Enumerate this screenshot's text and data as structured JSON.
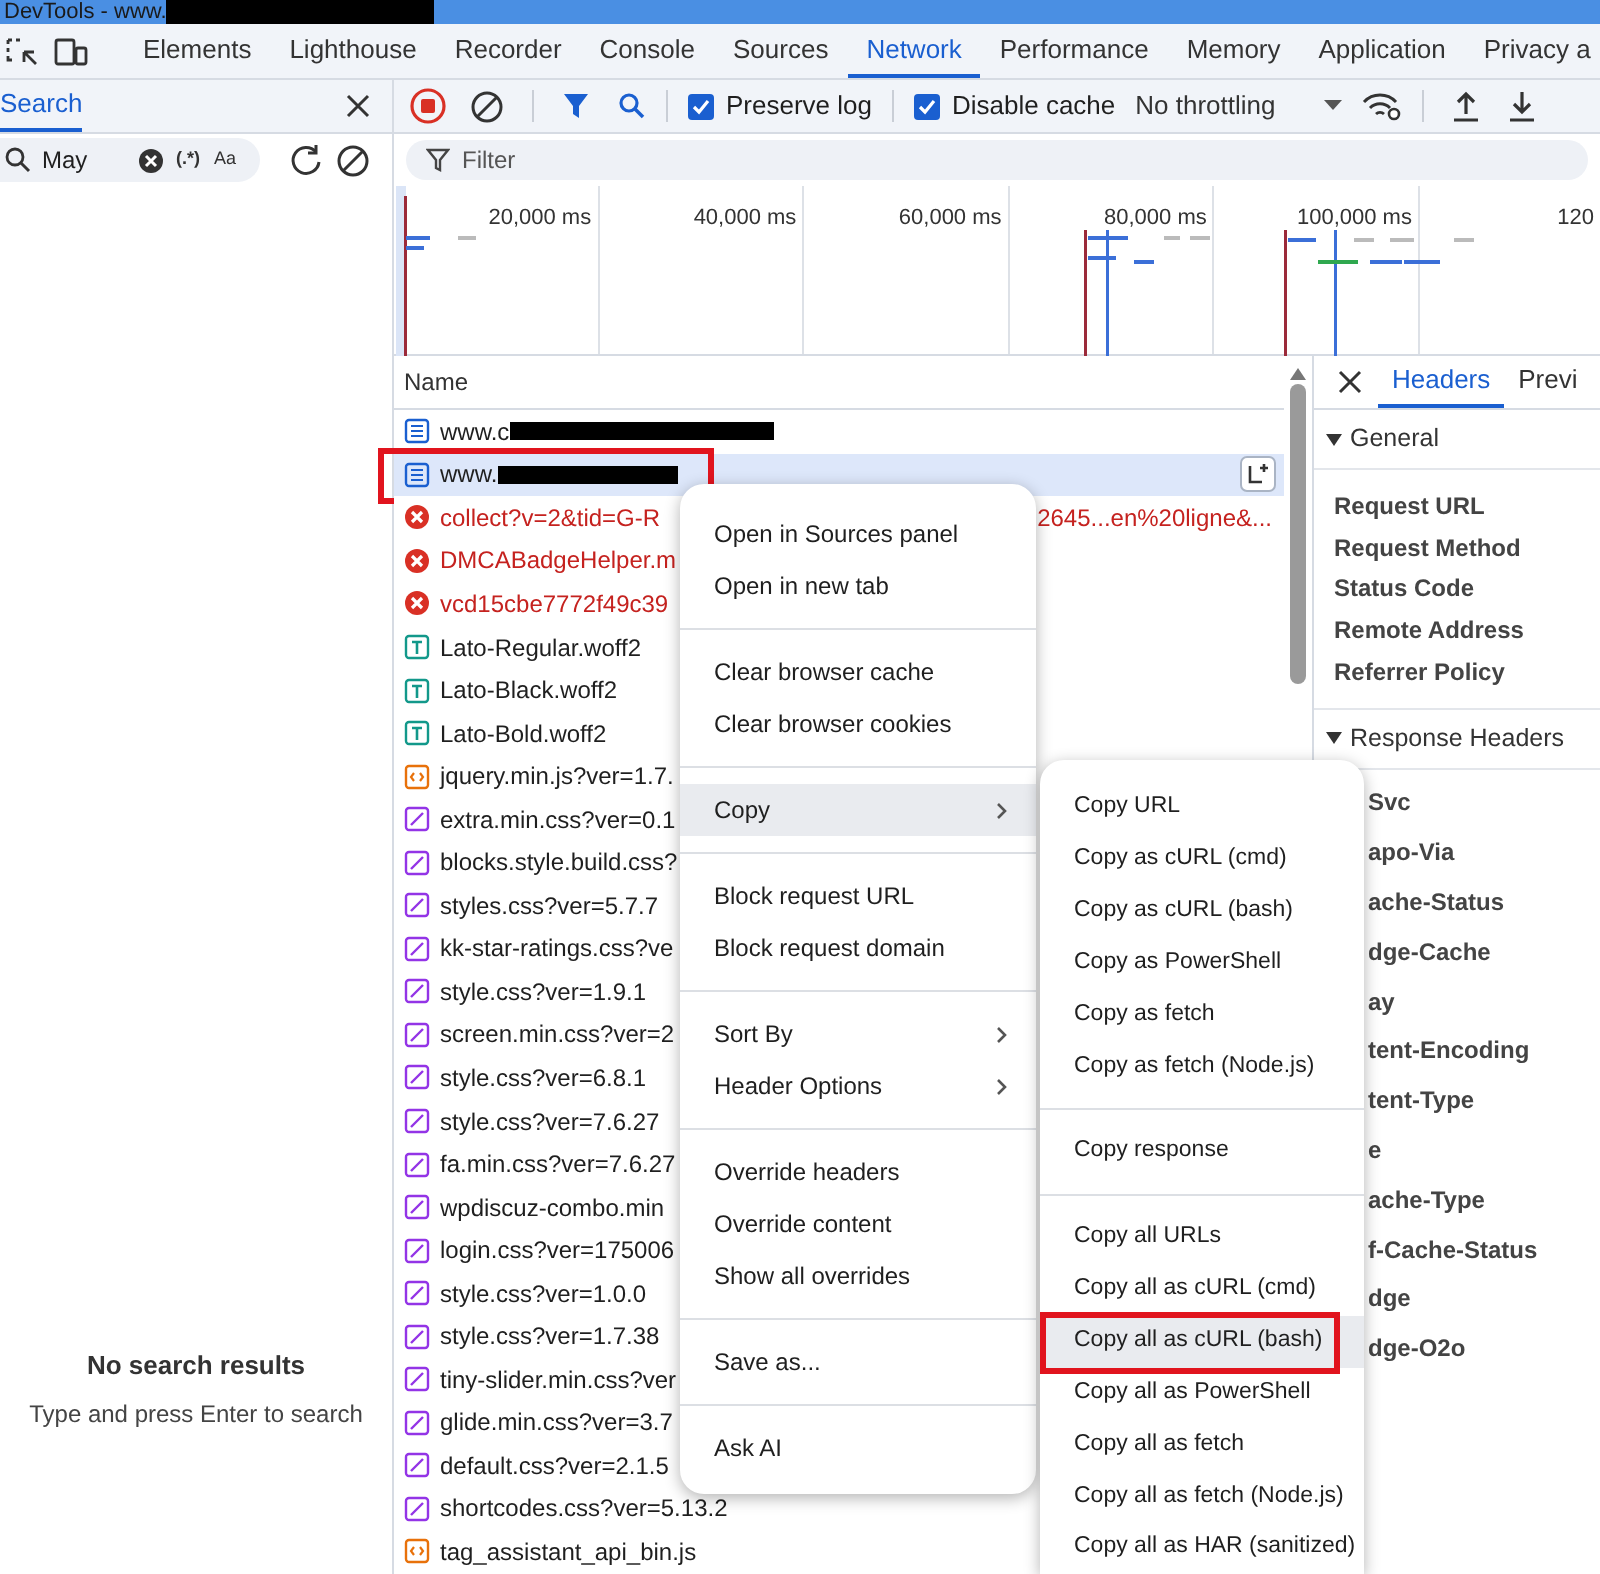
{
  "window": {
    "title": "DevTools - www."
  },
  "main_tabs": [
    {
      "label": "Elements",
      "selected": false
    },
    {
      "label": "Lighthouse",
      "selected": false
    },
    {
      "label": "Recorder",
      "selected": false
    },
    {
      "label": "Console",
      "selected": false
    },
    {
      "label": "Sources",
      "selected": false
    },
    {
      "label": "Network",
      "selected": true
    },
    {
      "label": "Performance",
      "selected": false
    },
    {
      "label": "Memory",
      "selected": false
    },
    {
      "label": "Application",
      "selected": false
    },
    {
      "label": "Privacy a",
      "selected": false
    }
  ],
  "search_panel": {
    "tab": {
      "label": "Search",
      "selected": true
    },
    "query": "May",
    "regex_label": "(.*)",
    "case_label": "Aa",
    "empty_title": "No search results",
    "empty_hint": "Type and press Enter to search"
  },
  "network_toolbar": {
    "recording": true,
    "preserve_log": {
      "label": "Preserve log",
      "checked": true
    },
    "disable_cache": {
      "label": "Disable cache",
      "checked": true
    },
    "throttling": "No throttling"
  },
  "filter": {
    "placeholder": "Filter"
  },
  "timeline": {
    "ticks": [
      "20,000 ms",
      "40,000 ms",
      "60,000 ms",
      "80,000 ms",
      "100,000 ms",
      "120"
    ]
  },
  "requests": {
    "column": "Name",
    "rows": [
      {
        "name": "www.c",
        "kind": "doc",
        "redacted": true,
        "selected": false,
        "annotated": false
      },
      {
        "name": "www.",
        "kind": "doc",
        "redacted": true,
        "selected": true,
        "annotated": true
      },
      {
        "name": "collect?v=2&tid=G-R",
        "tail": "2645...en%20ligne&...",
        "kind": "error",
        "redacted": false,
        "selected": false,
        "annotated": false
      },
      {
        "name": "DMCABadgeHelper.m",
        "kind": "error",
        "redacted": false,
        "selected": false,
        "annotated": false
      },
      {
        "name": "vcd15cbe7772f49c39",
        "kind": "error",
        "redacted": false,
        "selected": false,
        "annotated": false
      },
      {
        "name": "Lato-Regular.woff2",
        "kind": "font",
        "redacted": false,
        "selected": false,
        "annotated": false
      },
      {
        "name": "Lato-Black.woff2",
        "kind": "font",
        "redacted": false,
        "selected": false,
        "annotated": false
      },
      {
        "name": "Lato-Bold.woff2",
        "kind": "font",
        "redacted": false,
        "selected": false,
        "annotated": false
      },
      {
        "name": "jquery.min.js?ver=1.7.",
        "kind": "script",
        "redacted": false,
        "selected": false,
        "annotated": false
      },
      {
        "name": "extra.min.css?ver=0.1",
        "kind": "css",
        "redacted": false,
        "selected": false,
        "annotated": false
      },
      {
        "name": "blocks.style.build.css?",
        "kind": "css",
        "redacted": false,
        "selected": false,
        "annotated": false
      },
      {
        "name": "styles.css?ver=5.7.7",
        "kind": "css",
        "redacted": false,
        "selected": false,
        "annotated": false
      },
      {
        "name": "kk-star-ratings.css?ve",
        "kind": "css",
        "redacted": false,
        "selected": false,
        "annotated": false
      },
      {
        "name": "style.css?ver=1.9.1",
        "kind": "css",
        "redacted": false,
        "selected": false,
        "annotated": false
      },
      {
        "name": "screen.min.css?ver=2",
        "kind": "css",
        "redacted": false,
        "selected": false,
        "annotated": false
      },
      {
        "name": "style.css?ver=6.8.1",
        "kind": "css",
        "redacted": false,
        "selected": false,
        "annotated": false
      },
      {
        "name": "style.css?ver=7.6.27",
        "kind": "css",
        "redacted": false,
        "selected": false,
        "annotated": false
      },
      {
        "name": "fa.min.css?ver=7.6.27",
        "kind": "css",
        "redacted": false,
        "selected": false,
        "annotated": false
      },
      {
        "name": "wpdiscuz-combo.min",
        "kind": "css",
        "redacted": false,
        "selected": false,
        "annotated": false
      },
      {
        "name": "login.css?ver=175006",
        "kind": "css",
        "redacted": false,
        "selected": false,
        "annotated": false
      },
      {
        "name": "style.css?ver=1.0.0",
        "kind": "css",
        "redacted": false,
        "selected": false,
        "annotated": false
      },
      {
        "name": "style.css?ver=1.7.38",
        "kind": "css",
        "redacted": false,
        "selected": false,
        "annotated": false
      },
      {
        "name": "tiny-slider.min.css?ver",
        "kind": "css",
        "redacted": false,
        "selected": false,
        "annotated": false
      },
      {
        "name": "glide.min.css?ver=3.7",
        "kind": "css",
        "redacted": false,
        "selected": false,
        "annotated": false
      },
      {
        "name": "default.css?ver=2.1.5",
        "kind": "css",
        "redacted": false,
        "selected": false,
        "annotated": false
      },
      {
        "name": "shortcodes.css?ver=5.13.2",
        "kind": "css",
        "redacted": false,
        "selected": false,
        "annotated": false
      },
      {
        "name": "tag_assistant_api_bin.js",
        "kind": "script",
        "redacted": false,
        "selected": false,
        "annotated": false
      }
    ]
  },
  "context_menu": {
    "items": [
      {
        "kind": "item",
        "label": "Open in Sources panel"
      },
      {
        "kind": "item",
        "label": "Open in new tab"
      },
      {
        "kind": "separator"
      },
      {
        "kind": "item",
        "label": "Clear browser cache"
      },
      {
        "kind": "item",
        "label": "Clear browser cookies"
      },
      {
        "kind": "separator"
      },
      {
        "kind": "submenu",
        "label": "Copy",
        "expanded": true
      },
      {
        "kind": "separator"
      },
      {
        "kind": "item",
        "label": "Block request URL"
      },
      {
        "kind": "item",
        "label": "Block request domain"
      },
      {
        "kind": "separator"
      },
      {
        "kind": "submenu",
        "label": "Sort By",
        "expanded": false
      },
      {
        "kind": "submenu",
        "label": "Header Options",
        "expanded": false
      },
      {
        "kind": "separator"
      },
      {
        "kind": "item",
        "label": "Override headers"
      },
      {
        "kind": "item",
        "label": "Override content"
      },
      {
        "kind": "item",
        "label": "Show all overrides"
      },
      {
        "kind": "separator"
      },
      {
        "kind": "item",
        "label": "Save as..."
      },
      {
        "kind": "separator"
      },
      {
        "kind": "item",
        "label": "Ask AI"
      }
    ]
  },
  "copy_submenu": {
    "items": [
      {
        "kind": "item",
        "label": "Copy URL",
        "highlighted": false,
        "annotated": false
      },
      {
        "kind": "item",
        "label": "Copy as cURL (cmd)",
        "highlighted": false,
        "annotated": false
      },
      {
        "kind": "item",
        "label": "Copy as cURL (bash)",
        "highlighted": false,
        "annotated": false
      },
      {
        "kind": "item",
        "label": "Copy as PowerShell",
        "highlighted": false,
        "annotated": false
      },
      {
        "kind": "item",
        "label": "Copy as fetch",
        "highlighted": false,
        "annotated": false
      },
      {
        "kind": "item",
        "label": "Copy as fetch (Node.js)",
        "highlighted": false,
        "annotated": false
      },
      {
        "kind": "separator"
      },
      {
        "kind": "item",
        "label": "Copy response",
        "highlighted": false,
        "annotated": false
      },
      {
        "kind": "separator"
      },
      {
        "kind": "item",
        "label": "Copy all URLs",
        "highlighted": false,
        "annotated": false
      },
      {
        "kind": "item",
        "label": "Copy all as cURL (cmd)",
        "highlighted": false,
        "annotated": false
      },
      {
        "kind": "item",
        "label": "Copy all as cURL (bash)",
        "highlighted": true,
        "annotated": true
      },
      {
        "kind": "item",
        "label": "Copy all as PowerShell",
        "highlighted": false,
        "annotated": false
      },
      {
        "kind": "item",
        "label": "Copy all as fetch",
        "highlighted": false,
        "annotated": false
      },
      {
        "kind": "item",
        "label": "Copy all as fetch (Node.js)",
        "highlighted": false,
        "annotated": false
      },
      {
        "kind": "item",
        "label": "Copy all as HAR (sanitized)",
        "highlighted": false,
        "annotated": false
      }
    ]
  },
  "details": {
    "tabs": [
      {
        "label": "Headers",
        "selected": true
      },
      {
        "label": "Previ",
        "selected": false
      }
    ],
    "sections": [
      {
        "title": "General",
        "expanded": true,
        "items": [
          "Request URL",
          "Request Method",
          "Status Code",
          "Remote Address",
          "Referrer Policy"
        ]
      },
      {
        "title": "Response Headers",
        "expanded": true,
        "items": [
          "Svc",
          "apo-Via",
          "ache-Status",
          "dge-Cache",
          "ay",
          "tent-Encoding",
          "tent-Type",
          "e",
          "ache-Type",
          "f-Cache-Status",
          "dge",
          "dge-O2o"
        ]
      }
    ]
  }
}
